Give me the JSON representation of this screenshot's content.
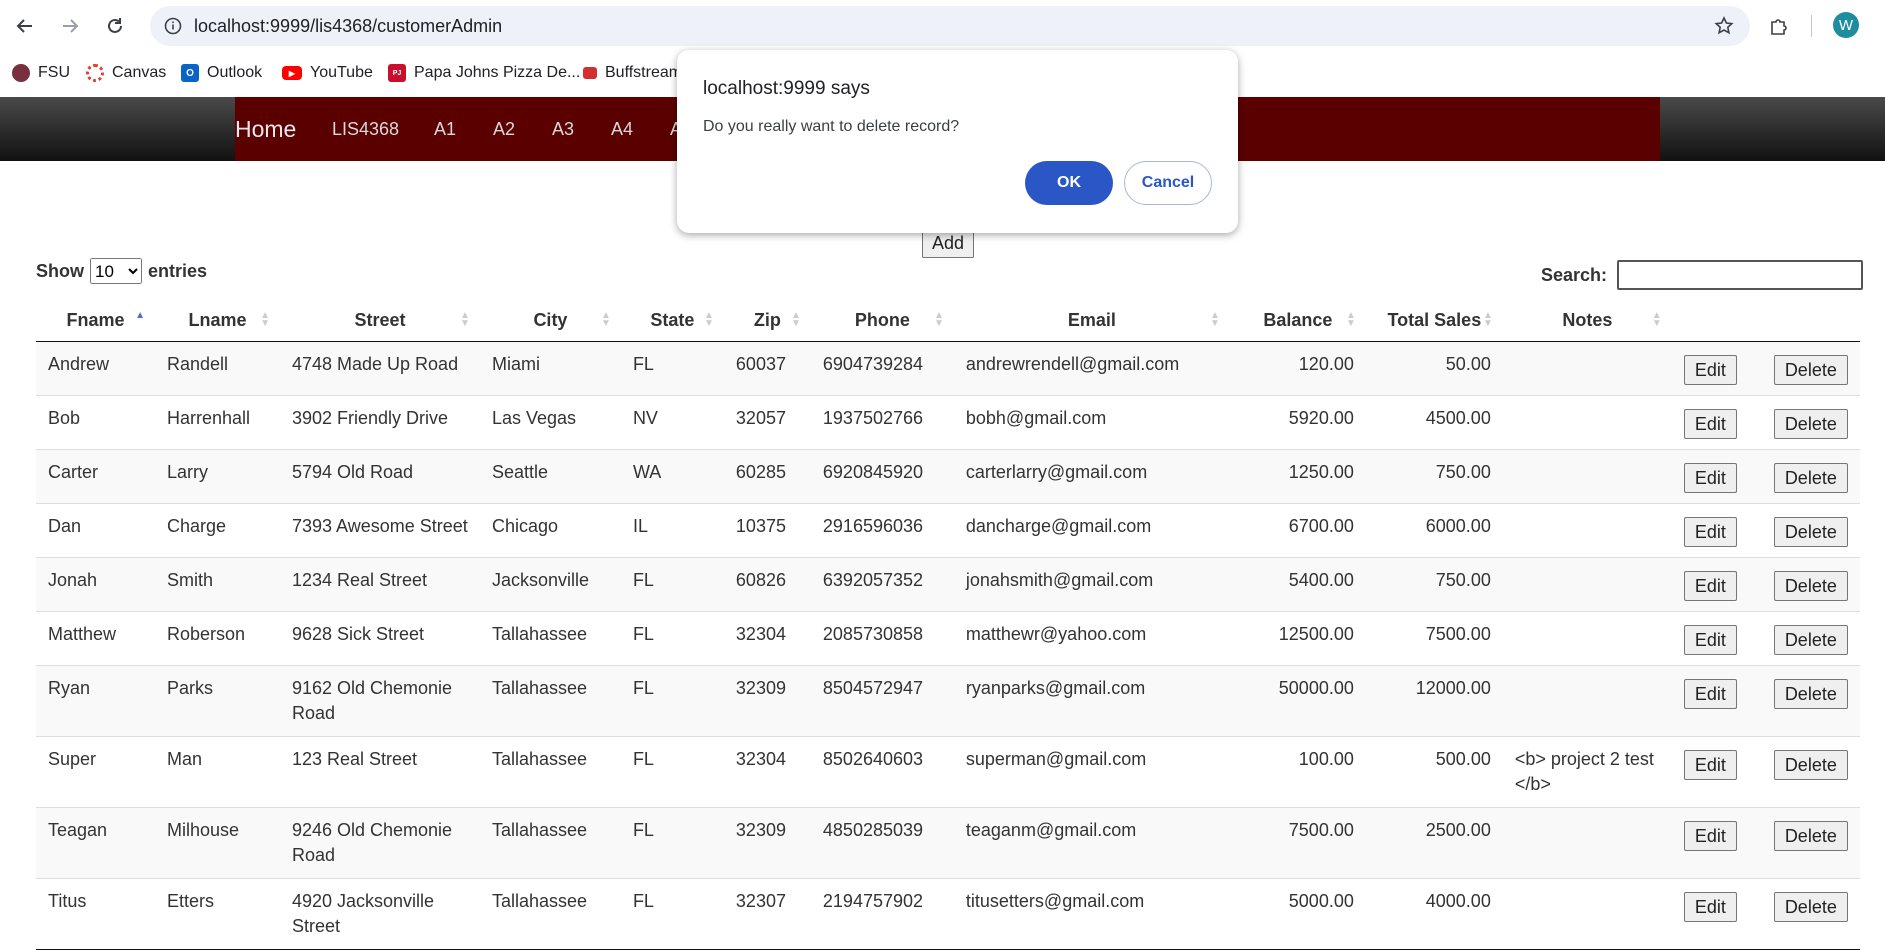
{
  "browser": {
    "url": "localhost:9999/lis4368/customerAdmin",
    "profile_initial": "W",
    "bookmarks": [
      {
        "label": "FSU",
        "icon": "fsu-seal-icon",
        "color": "#782f40"
      },
      {
        "label": "Canvas",
        "icon": "canvas-icon",
        "color": "#e13f2b"
      },
      {
        "label": "Outlook",
        "icon": "outlook-icon",
        "color": "#0a64c8"
      },
      {
        "label": "YouTube",
        "icon": "youtube-icon",
        "color": "#ff0000"
      },
      {
        "label": "Papa Johns Pizza De...",
        "icon": "papa-johns-icon",
        "color": "#c8102e"
      },
      {
        "label": "Buffstream",
        "icon": "buffstream-icon",
        "color": "#d32f2f"
      }
    ]
  },
  "nav": {
    "home": "Home",
    "items": [
      "LIS4368",
      "A1",
      "A2",
      "A3",
      "A4",
      "A"
    ]
  },
  "page": {
    "add_label": "Add",
    "show_prefix": "Show",
    "show_value": "10",
    "show_suffix": "entries",
    "search_label": "Search:",
    "search_value": ""
  },
  "table": {
    "headers": [
      "Fname",
      "Lname",
      "Street",
      "City",
      "State",
      "Zip",
      "Phone",
      "Email",
      "Balance",
      "Total Sales",
      "Notes"
    ],
    "edit_label": "Edit",
    "delete_label": "Delete",
    "rows": [
      [
        "Andrew",
        "Randell",
        "4748 Made Up Road",
        "Miami",
        "FL",
        "60037",
        "6904739284",
        "andrewrendell@gmail.com",
        "120.00",
        "50.00",
        ""
      ],
      [
        "Bob",
        "Harrenhall",
        "3902 Friendly Drive",
        "Las Vegas",
        "NV",
        "32057",
        "1937502766",
        "bobh@gmail.com",
        "5920.00",
        "4500.00",
        ""
      ],
      [
        "Carter",
        "Larry",
        "5794 Old Road",
        "Seattle",
        "WA",
        "60285",
        "6920845920",
        "carterlarry@gmail.com",
        "1250.00",
        "750.00",
        ""
      ],
      [
        "Dan",
        "Charge",
        "7393 Awesome Street",
        "Chicago",
        "IL",
        "10375",
        "2916596036",
        "dancharge@gmail.com",
        "6700.00",
        "6000.00",
        ""
      ],
      [
        "Jonah",
        "Smith",
        "1234 Real Street",
        "Jacksonville",
        "FL",
        "60826",
        "6392057352",
        "jonahsmith@gmail.com",
        "5400.00",
        "750.00",
        ""
      ],
      [
        "Matthew",
        "Roberson",
        "9628 Sick Street",
        "Tallahassee",
        "FL",
        "32304",
        "2085730858",
        "matthewr@yahoo.com",
        "12500.00",
        "7500.00",
        ""
      ],
      [
        "Ryan",
        "Parks",
        "9162 Old Chemonie Road",
        "Tallahassee",
        "FL",
        "32309",
        "8504572947",
        "ryanparks@gmail.com",
        "50000.00",
        "12000.00",
        ""
      ],
      [
        "Super",
        "Man",
        "123 Real Street",
        "Tallahassee",
        "FL",
        "32304",
        "8502640603",
        "superman@gmail.com",
        "100.00",
        "500.00",
        "<b> project 2 test </b>"
      ],
      [
        "Teagan",
        "Milhouse",
        "9246 Old Chemonie Road",
        "Tallahassee",
        "FL",
        "32309",
        "4850285039",
        "teaganm@gmail.com",
        "7500.00",
        "2500.00",
        ""
      ],
      [
        "Titus",
        "Etters",
        "4920 Jacksonville Street",
        "Tallahassee",
        "FL",
        "32307",
        "2194757902",
        "titusetters@gmail.com",
        "5000.00",
        "4000.00",
        ""
      ]
    ]
  },
  "dialog": {
    "title": "localhost:9999 says",
    "message": "Do you really want to delete record?",
    "ok_label": "OK",
    "cancel_label": "Cancel"
  }
}
